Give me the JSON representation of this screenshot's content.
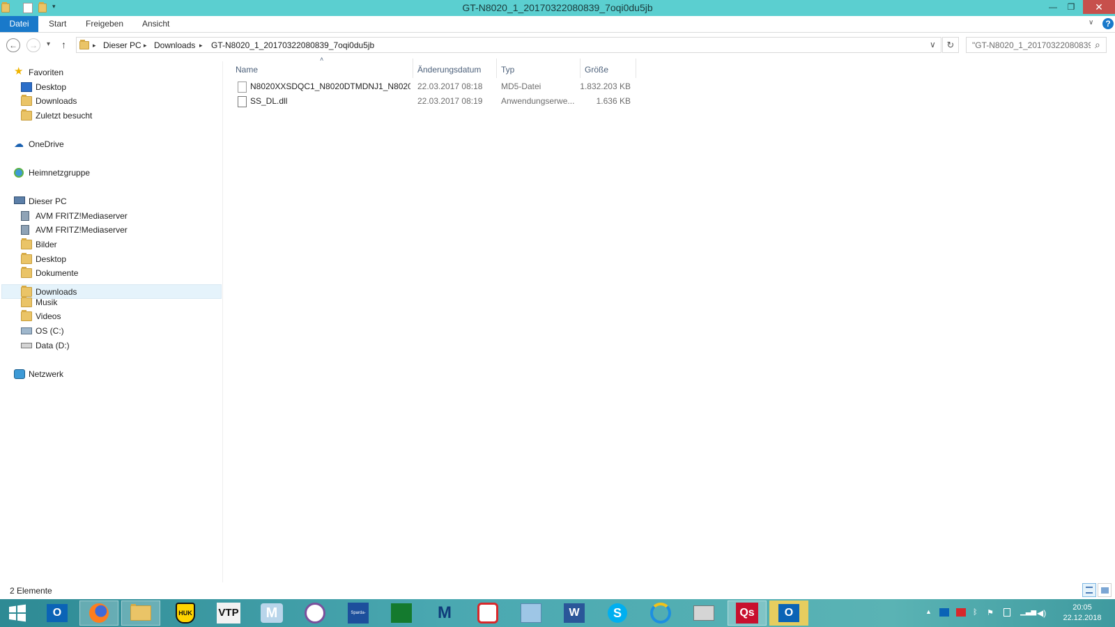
{
  "window": {
    "title": "GT-N8020_1_20170322080839_7oqi0du5jb",
    "minimize_glyph": "—",
    "restore_glyph": "❐",
    "close_glyph": "✕"
  },
  "ribbon": {
    "tabs": [
      {
        "label": "Datei"
      },
      {
        "label": "Start"
      },
      {
        "label": "Freigeben"
      },
      {
        "label": "Ansicht"
      }
    ],
    "help_glyph": "?",
    "collapse_glyph": "∨"
  },
  "address": {
    "back_glyph": "←",
    "forward_glyph": "→",
    "recent_glyph": "▾",
    "up_glyph": "↑",
    "crumbs": [
      "Dieser PC",
      "Downloads",
      "GT-N8020_1_20170322080839_7oqi0du5jb"
    ],
    "sep_glyph": "▸",
    "dropdown_glyph": "∨",
    "refresh_glyph": "↻",
    "search_placeholder": "\"GT-N8020_1_20170322080839...",
    "search_glyph": "⌕"
  },
  "nav": {
    "favoriten": "Favoriten",
    "fav_items": [
      "Desktop",
      "Downloads",
      "Zuletzt besucht"
    ],
    "onedrive": "OneDrive",
    "heimnetz": "Heimnetzgruppe",
    "dieser_pc": "Dieser PC",
    "pc_items": [
      "AVM FRITZ!Mediaserver",
      "AVM FRITZ!Mediaserver",
      "Bilder",
      "Desktop",
      "Dokumente",
      "Downloads",
      "Musik",
      "Videos",
      "OS (C:)",
      "Data (D:)"
    ],
    "netzwerk": "Netzwerk"
  },
  "columns": {
    "name": "Name",
    "date": "Änderungsdatum",
    "type": "Typ",
    "size": "Größe",
    "sort_glyph": "˄"
  },
  "files": [
    {
      "name": "N8020XXSDQC1_N8020DTMDNJ1_N8020...",
      "date": "22.03.2017 08:18",
      "type": "MD5-Datei",
      "size": "1.832.203 KB"
    },
    {
      "name": "SS_DL.dll",
      "date": "22.03.2017 08:19",
      "type": "Anwendungserwe...",
      "size": "1.636 KB"
    }
  ],
  "status": {
    "count": "2 Elemente"
  },
  "taskbar": {
    "vtp_label": "VTP",
    "huk_label": "HUK",
    "word_label": "W",
    "skype_label": "S",
    "qs_label": "Qs",
    "outlook_label": "O",
    "m_label": "M",
    "sparda_label": "Sparda-Bank"
  },
  "clock": {
    "time": "20:05",
    "date": "22.12.2018"
  }
}
